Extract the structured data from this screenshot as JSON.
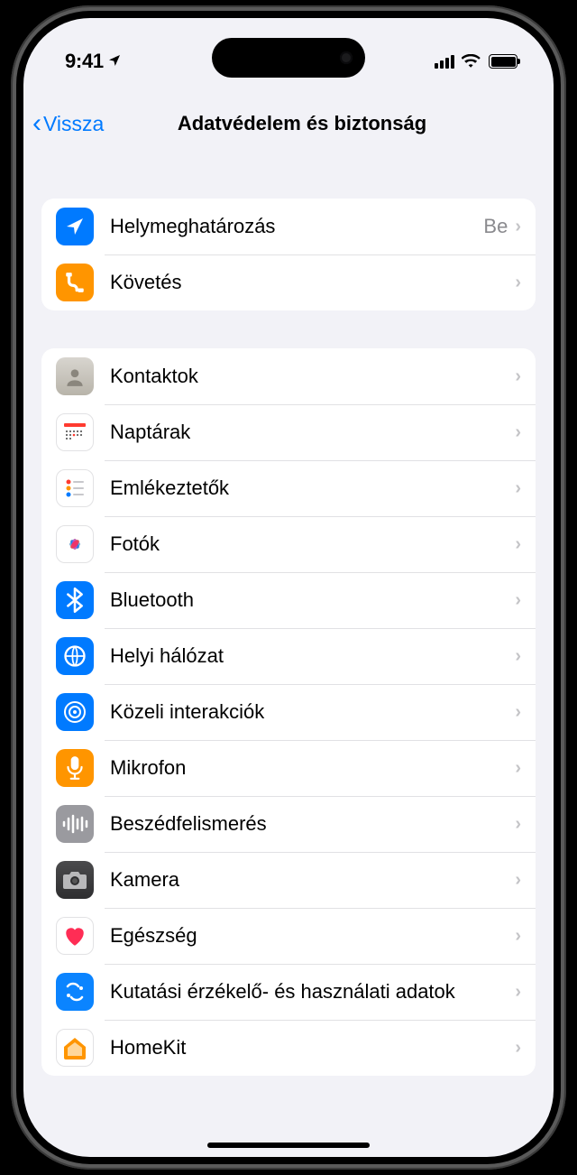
{
  "status": {
    "time": "9:41"
  },
  "nav": {
    "back_label": "Vissza",
    "title": "Adatvédelem és biztonság"
  },
  "group1": [
    {
      "label": "Helymeghatározás",
      "value": "Be",
      "icon": "location-arrow"
    },
    {
      "label": "Követés",
      "value": "",
      "icon": "tracking"
    }
  ],
  "group2": [
    {
      "label": "Kontaktok",
      "icon": "contacts"
    },
    {
      "label": "Naptárak",
      "icon": "calendar"
    },
    {
      "label": "Emlékeztetők",
      "icon": "reminders"
    },
    {
      "label": "Fotók",
      "icon": "photos"
    },
    {
      "label": "Bluetooth",
      "icon": "bluetooth"
    },
    {
      "label": "Helyi hálózat",
      "icon": "local-network"
    },
    {
      "label": "Közeli interakciók",
      "icon": "nearby"
    },
    {
      "label": "Mikrofon",
      "icon": "microphone"
    },
    {
      "label": "Beszédfelismerés",
      "icon": "speech"
    },
    {
      "label": "Kamera",
      "icon": "camera"
    },
    {
      "label": "Egészség",
      "icon": "health"
    },
    {
      "label": "Kutatási érzékelő- és használati adatok",
      "icon": "research"
    },
    {
      "label": "HomeKit",
      "icon": "homekit"
    }
  ]
}
